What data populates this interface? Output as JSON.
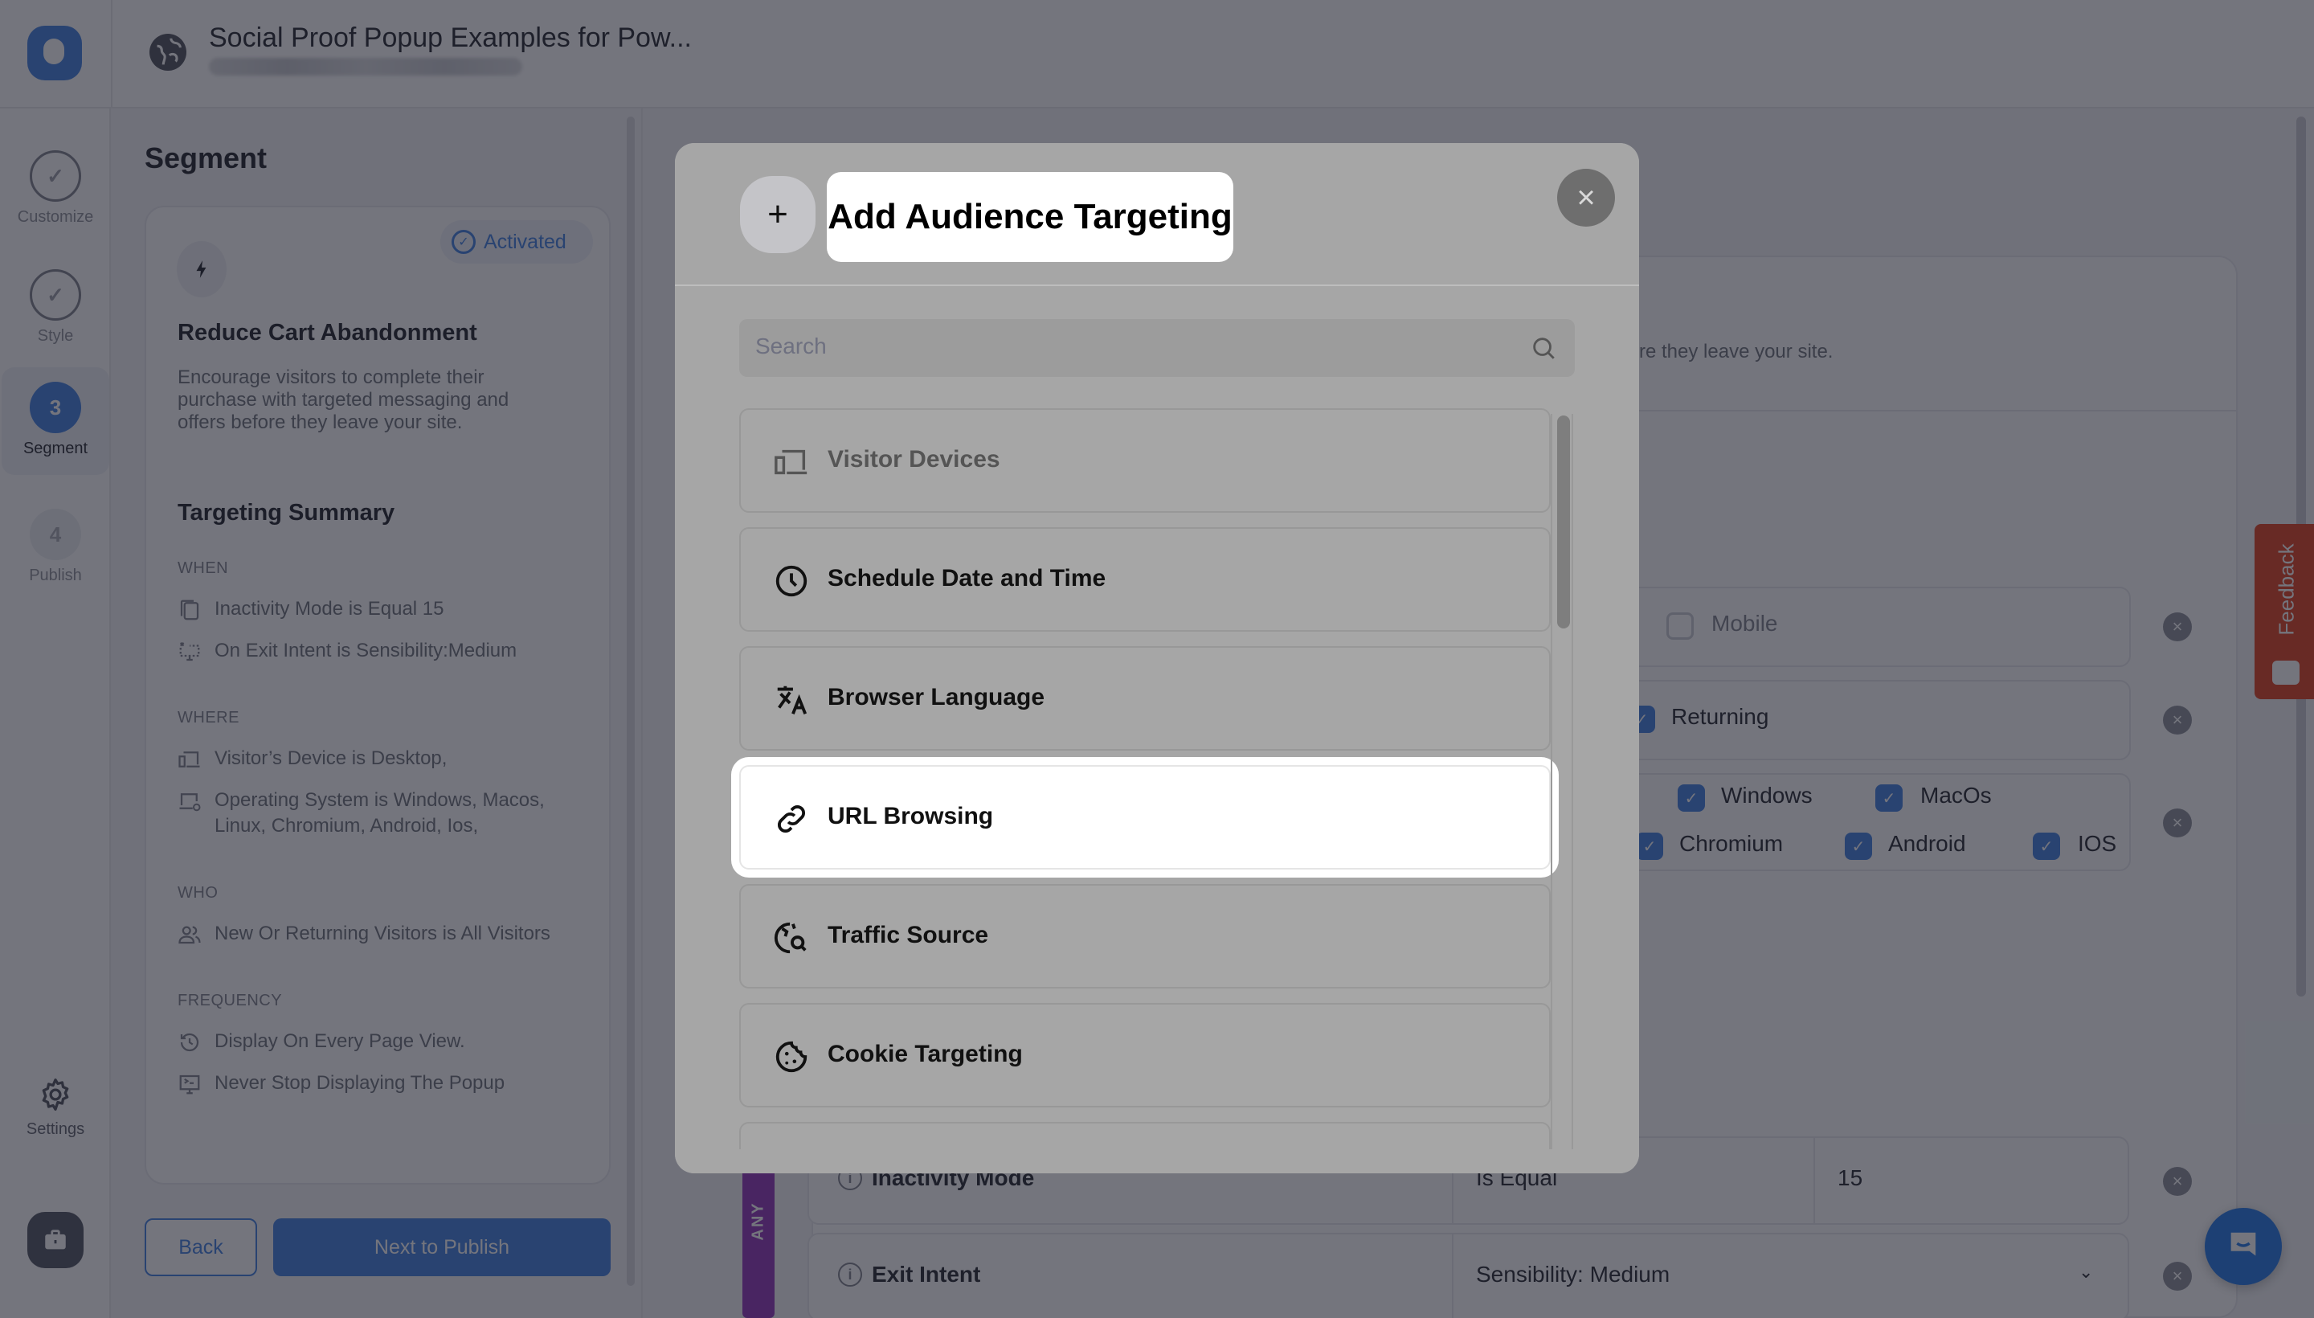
{
  "header": {
    "title": "Social Proof Popup Examples for Pow...",
    "globe_icon": "globe-icon",
    "logo_icon": "app-logo"
  },
  "steps": [
    {
      "label": "Customize",
      "state": "done",
      "mark": "✓"
    },
    {
      "label": "Style",
      "state": "done",
      "mark": "✓"
    },
    {
      "label": "Segment",
      "state": "active",
      "mark": "3"
    },
    {
      "label": "Publish",
      "state": "todo",
      "mark": "4"
    }
  ],
  "rail_bottom": {
    "settings_label": "Settings"
  },
  "left_panel": {
    "title": "Segment",
    "goal": {
      "badge": "Activated",
      "title": "Reduce Cart Abandonment",
      "description": "Encourage visitors to complete their purchase with targeted messaging and offers before they leave your site."
    },
    "summary_title": "Targeting Summary",
    "sections": [
      {
        "label": "WHEN",
        "items": [
          {
            "icon": "inactivity-icon",
            "text": "Inactivity Mode is Equal 15"
          },
          {
            "icon": "exit-intent-icon",
            "text": "On Exit Intent is Sensibility:Medium"
          }
        ]
      },
      {
        "label": "WHERE",
        "items": [
          {
            "icon": "devices-icon",
            "text": "Visitor’s Device is Desktop,"
          },
          {
            "icon": "os-icon",
            "text": "Operating System is Windows, Macos, Linux, Chromium, Android, Ios,"
          }
        ]
      },
      {
        "label": "WHO",
        "items": [
          {
            "icon": "users-icon",
            "text": "New Or Returning Visitors is All Visitors"
          }
        ]
      },
      {
        "label": "FREQUENCY",
        "items": [
          {
            "icon": "history-icon",
            "text": "Display On Every Page View."
          },
          {
            "icon": "display-icon",
            "text": "Never Stop Displaying The Popup"
          }
        ]
      }
    ],
    "back_label": "Back",
    "next_label": "Next to Publish"
  },
  "background": {
    "desc_fragment": "re they leave your site.",
    "device_options": [
      {
        "label": "Mobile",
        "checked": false
      }
    ],
    "visitor_options": [
      {
        "label": "Returning",
        "checked": true
      }
    ],
    "os_options": [
      {
        "label": "Windows",
        "checked": true
      },
      {
        "label": "MacOs",
        "checked": true
      },
      {
        "label": "Chromium",
        "checked": true
      },
      {
        "label": "Android",
        "checked": true
      },
      {
        "label": "IOS",
        "checked": true
      }
    ],
    "logic_label": "ANY",
    "conditions": [
      {
        "name": "Inactivity Mode",
        "operator": "Is Equal",
        "value": "15"
      },
      {
        "name": "Exit Intent",
        "operator": "Sensibility: Medium",
        "value": ""
      }
    ],
    "feedback_label": "Feedback"
  },
  "modal": {
    "title": "Add Audience Targeting",
    "search_placeholder": "Search",
    "options": [
      {
        "label": "Visitor Devices",
        "icon": "devices-icon",
        "state": "disabled"
      },
      {
        "label": "Schedule Date and Time",
        "icon": "clock-icon",
        "state": "normal"
      },
      {
        "label": "Browser Language",
        "icon": "translate-icon",
        "state": "normal"
      },
      {
        "label": "URL Browsing",
        "icon": "link-icon",
        "state": "highlighted"
      },
      {
        "label": "Traffic Source",
        "icon": "traffic-source-icon",
        "state": "normal"
      },
      {
        "label": "Cookie Targeting",
        "icon": "cookie-icon",
        "state": "normal"
      },
      {
        "label": "",
        "icon": "",
        "state": "normal"
      }
    ]
  }
}
